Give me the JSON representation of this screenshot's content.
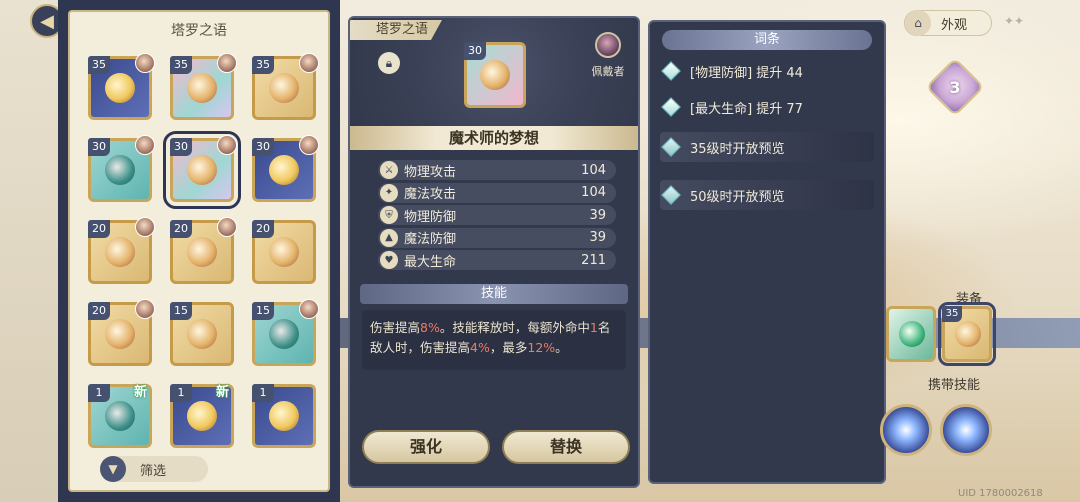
{
  "left": {
    "title": "塔罗之语",
    "filter_label": "筛选",
    "cards": [
      {
        "level": "35",
        "rarity": "r-navy",
        "new": "",
        "has_owner": true
      },
      {
        "level": "35",
        "rarity": "r-pink",
        "new": "",
        "has_owner": true
      },
      {
        "level": "35",
        "rarity": "r-gold",
        "new": "",
        "has_owner": true
      },
      {
        "level": "30",
        "rarity": "r-teal",
        "new": "",
        "has_owner": true
      },
      {
        "level": "30",
        "rarity": "r-pink",
        "new": "",
        "has_owner": true,
        "selected": true
      },
      {
        "level": "30",
        "rarity": "r-navy",
        "new": "",
        "has_owner": true
      },
      {
        "level": "20",
        "rarity": "r-gold",
        "new": "",
        "has_owner": true
      },
      {
        "level": "20",
        "rarity": "r-gold",
        "new": "",
        "has_owner": true
      },
      {
        "level": "20",
        "rarity": "r-gold",
        "new": "",
        "has_owner": false
      },
      {
        "level": "20",
        "rarity": "r-gold",
        "new": "",
        "has_owner": true
      },
      {
        "level": "15",
        "rarity": "r-gold",
        "new": "",
        "has_owner": false
      },
      {
        "level": "15",
        "rarity": "r-teal",
        "new": "",
        "has_owner": true
      },
      {
        "level": "1",
        "rarity": "r-teal",
        "new": "新",
        "has_owner": false
      },
      {
        "level": "1",
        "rarity": "r-navy",
        "new": "新",
        "has_owner": false
      },
      {
        "level": "1",
        "rarity": "r-navy",
        "new": "",
        "has_owner": false
      }
    ]
  },
  "detail": {
    "tab": "塔罗之语",
    "card_level": "30",
    "wearer_label": "佩戴者",
    "card_name": "魔术师的梦想",
    "stats": [
      {
        "icon": "sword-icon",
        "glyph": "⚔",
        "name": "物理攻击",
        "value": "104"
      },
      {
        "icon": "wand-icon",
        "glyph": "✦",
        "name": "魔法攻击",
        "value": "104"
      },
      {
        "icon": "shield-icon",
        "glyph": "⛨",
        "name": "物理防御",
        "value": "39"
      },
      {
        "icon": "hat-icon",
        "glyph": "▲",
        "name": "魔法防御",
        "value": "39"
      },
      {
        "icon": "heart-icon",
        "glyph": "♥",
        "name": "最大生命",
        "value": "211"
      }
    ],
    "skill_title": "技能",
    "skill_desc": {
      "p1": "伤害提高",
      "v1": "8%",
      "p2": "。技能释放时，每额外命中",
      "v2": "1",
      "p3": "名敌人时，伤害提高",
      "v3": "4%",
      "p4": "，最多",
      "v4": "12%",
      "p5": "。"
    },
    "enhance_label": "强化",
    "replace_label": "替换"
  },
  "affix": {
    "title": "词条",
    "rows": [
      {
        "text": "[物理防御] 提升 44",
        "locked": false
      },
      {
        "text": "[最大生命] 提升 77",
        "locked": false
      },
      {
        "text": "35级时开放预览",
        "locked": true
      },
      {
        "text": "50级时开放预览",
        "locked": true
      }
    ]
  },
  "side": {
    "appearance_label": "外观",
    "heart_level": "3",
    "equip_label": "装备",
    "equip_level": "35",
    "skills_label": "携带技能",
    "uid": "UID 1780002618"
  },
  "colors": {
    "panel_dark": "#33394c",
    "gold_border": "#c9a55a",
    "highlight_red": "#f07a63"
  }
}
